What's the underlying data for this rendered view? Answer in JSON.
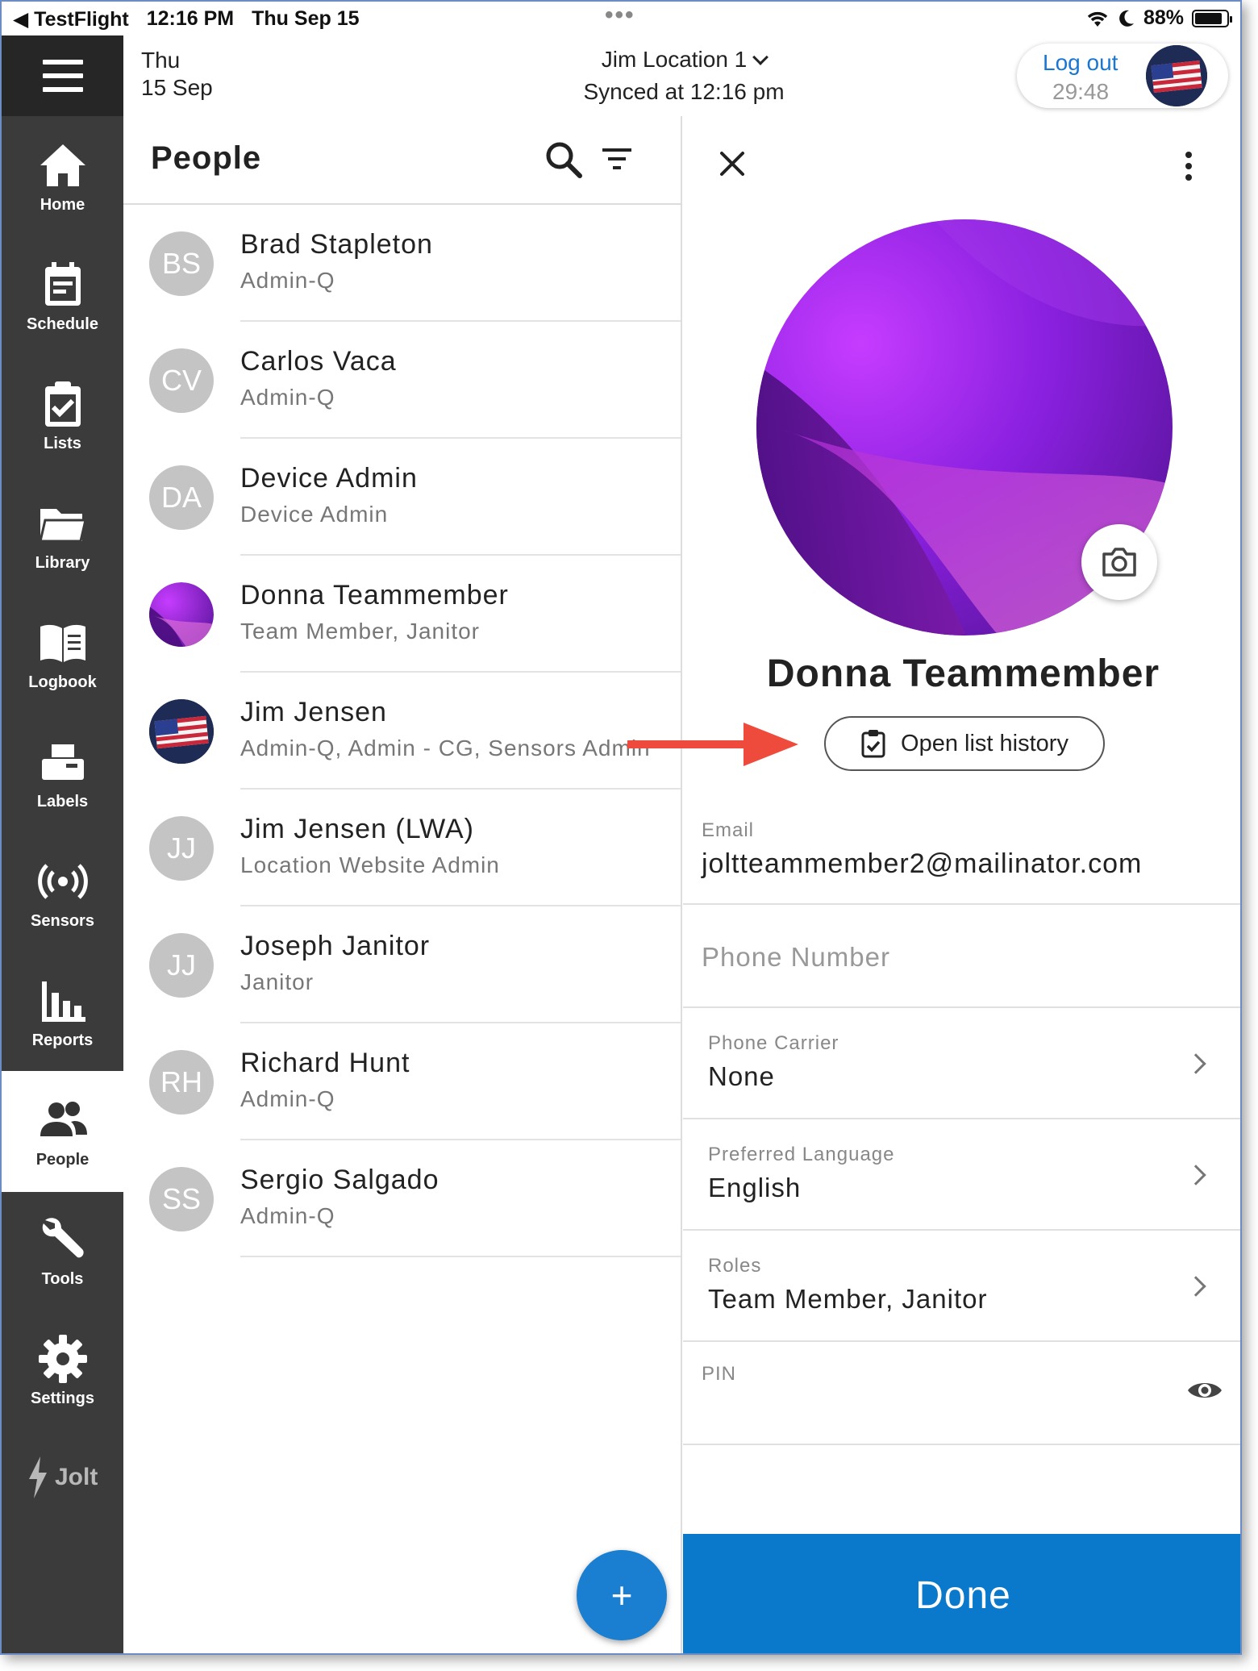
{
  "status_bar": {
    "app": "TestFlight",
    "time": "12:16 PM",
    "date": "Thu Sep 15",
    "battery": "88%",
    "battery_level": 0.88
  },
  "header": {
    "day": "Thu",
    "date": "15 Sep",
    "location": "Jim Location 1",
    "synced": "Synced at 12:16 pm",
    "logout_label": "Log out",
    "logout_timer": "29:48"
  },
  "nav": {
    "items": [
      {
        "label": "Home",
        "icon": "home-icon"
      },
      {
        "label": "Schedule",
        "icon": "schedule-icon"
      },
      {
        "label": "Lists",
        "icon": "clipboard-check-icon"
      },
      {
        "label": "Library",
        "icon": "folder-icon"
      },
      {
        "label": "Logbook",
        "icon": "book-icon"
      },
      {
        "label": "Labels",
        "icon": "label-printer-icon"
      },
      {
        "label": "Sensors",
        "icon": "sensor-icon"
      },
      {
        "label": "Reports",
        "icon": "bar-chart-icon"
      },
      {
        "label": "People",
        "icon": "people-icon"
      },
      {
        "label": "Tools",
        "icon": "wrench-icon"
      },
      {
        "label": "Settings",
        "icon": "gear-icon"
      }
    ],
    "active": "People",
    "brand": "Jolt"
  },
  "people_list": {
    "title": "People",
    "people": [
      {
        "initials": "BS",
        "name": "Brad Stapleton",
        "role": "Admin-Q"
      },
      {
        "initials": "CV",
        "name": "Carlos Vaca",
        "role": "Admin-Q"
      },
      {
        "initials": "DA",
        "name": "Device Admin",
        "role": "Device Admin"
      },
      {
        "initials": "",
        "name": "Donna Teammember",
        "role": "Team Member, Janitor"
      },
      {
        "initials": "",
        "name": "Jim Jensen",
        "role": "Admin-Q, Admin - CG, Sensors Admin"
      },
      {
        "initials": "JJ",
        "name": "Jim Jensen (LWA)",
        "role": "Location Website Admin"
      },
      {
        "initials": "JJ",
        "name": "Joseph Janitor",
        "role": "Janitor"
      },
      {
        "initials": "RH",
        "name": "Richard Hunt",
        "role": "Admin-Q"
      },
      {
        "initials": "SS",
        "name": "Sergio Salgado",
        "role": "Admin-Q"
      }
    ],
    "fab_label": "+"
  },
  "detail": {
    "name": "Donna Teammember",
    "history_button": "Open list history",
    "email_label": "Email",
    "email": "joltteammember2@mailinator.com",
    "phone_placeholder": "Phone Number",
    "carrier_label": "Phone Carrier",
    "carrier": "None",
    "language_label": "Preferred Language",
    "language": "English",
    "roles_label": "Roles",
    "roles": "Team Member, Janitor",
    "pin_label": "PIN",
    "done": "Done"
  },
  "colors": {
    "nav_bg": "#3b3b3b",
    "accent_blue": "#0a79cc",
    "link_blue": "#1976d2",
    "annotation_red": "#ef4b3c"
  }
}
